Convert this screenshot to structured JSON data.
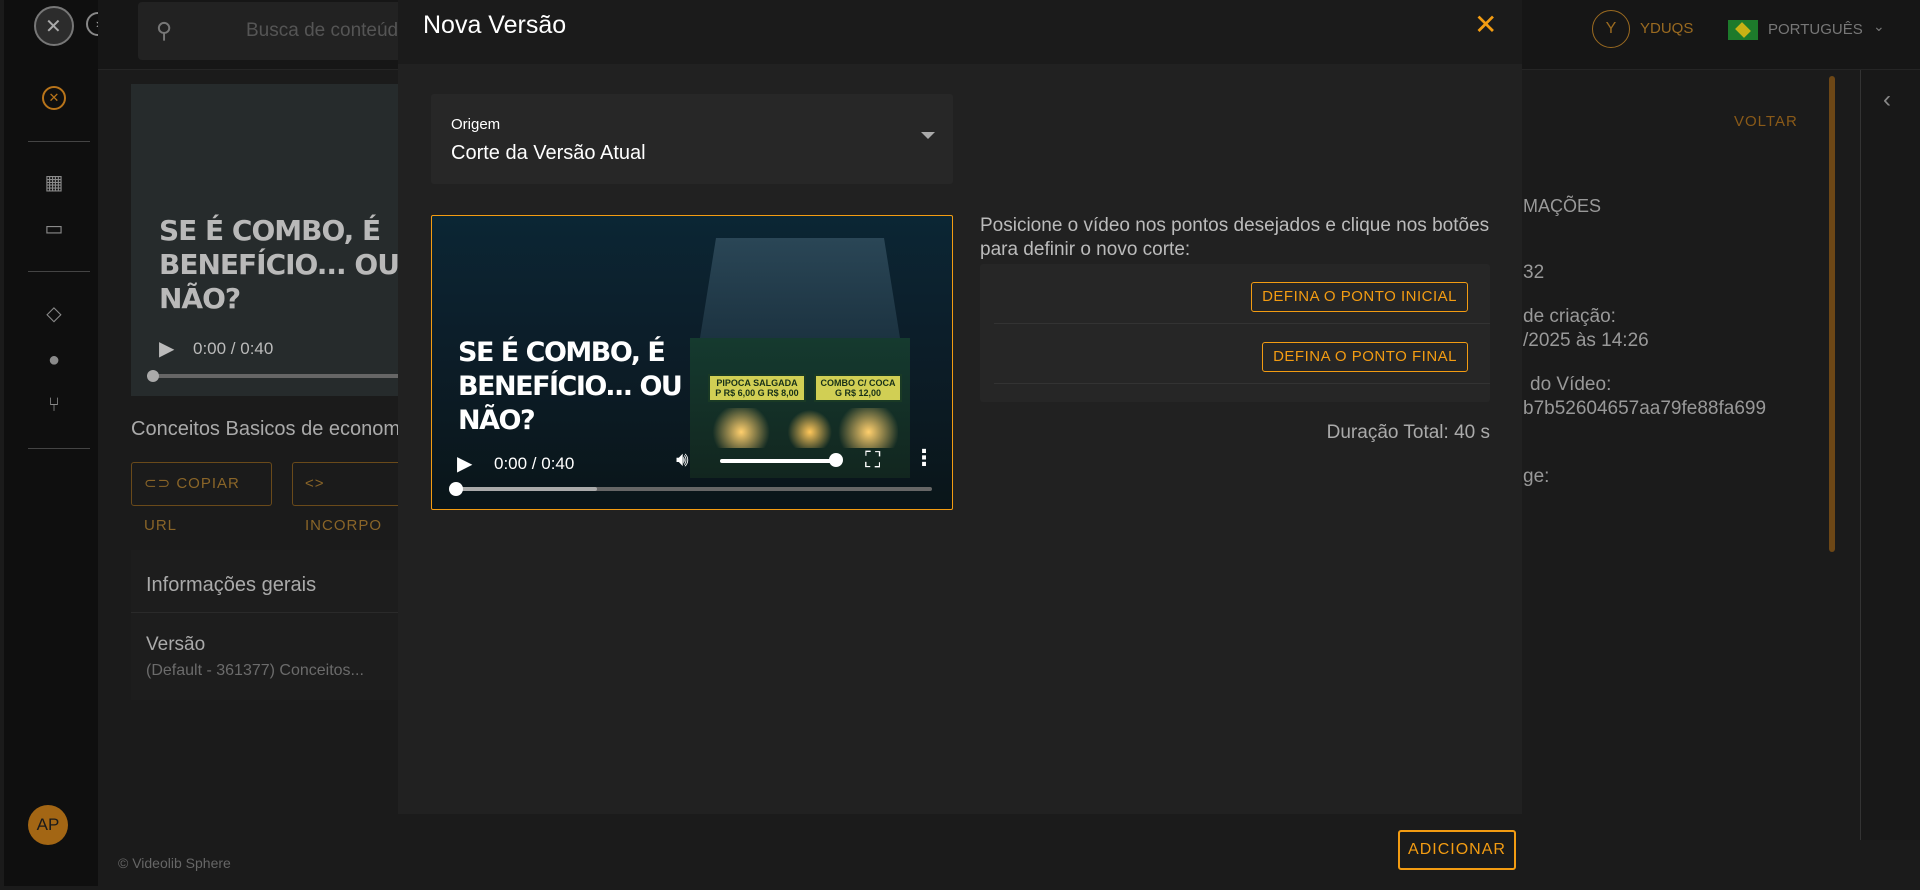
{
  "background": {
    "search_placeholder": "Busca de conteúdos",
    "user_initial": "Y",
    "user_name": "YDUQS",
    "language": "PORTUGUÊS",
    "avatar_initials": "AP",
    "video_overlay": "SE É COMBO, É BENEFÍCIO... OU NÃO?",
    "video_time": "0:00 / 0:40",
    "content_title": "Conceitos Basicos de econom",
    "copy_url": "COPIAR URL",
    "embed": "INCORPO",
    "general_info": "Informações gerais",
    "version_label": "Versão",
    "version_value": "(Default - 361377) Conceitos...",
    "footer": "© Videolib Sphere",
    "voltar": "VOLTAR",
    "info_lines": [
      "MAÇÕES",
      "32",
      "de criação:",
      "/2025 às 14:26",
      "do Vídeo:",
      "b7b52604657aa79fe88fa699",
      "ge:"
    ]
  },
  "modal": {
    "title": "Nova Versão",
    "origin": {
      "label": "Origem",
      "value": "Corte da Versão Atual"
    },
    "player": {
      "overlay_text": "SE É COMBO, É BENEFÍCIO... OU NÃO?",
      "time": "0:00 / 0:40",
      "progress_buffered": 0.3,
      "volume": 0.95,
      "sign_left_title": "PIPOCA SALGADA",
      "sign_left_price": "P R$ 6,00 G R$ 8,00",
      "sign_right_title": "COMBO C/ COCA",
      "sign_right_price": "G R$ 12,00"
    },
    "instructions": "Posicione o vídeo nos pontos desejados e clique nos botões para definir o novo corte:",
    "start_button": "DEFINA O PONTO INICIAL",
    "end_button": "DEFINA O PONTO FINAL",
    "duration": "Duração Total: 40 s",
    "add_button": "ADICIONAR"
  },
  "colors": {
    "accent": "#f39c12",
    "modal_bg": "#212121",
    "header_bg": "#1b1b1b"
  }
}
